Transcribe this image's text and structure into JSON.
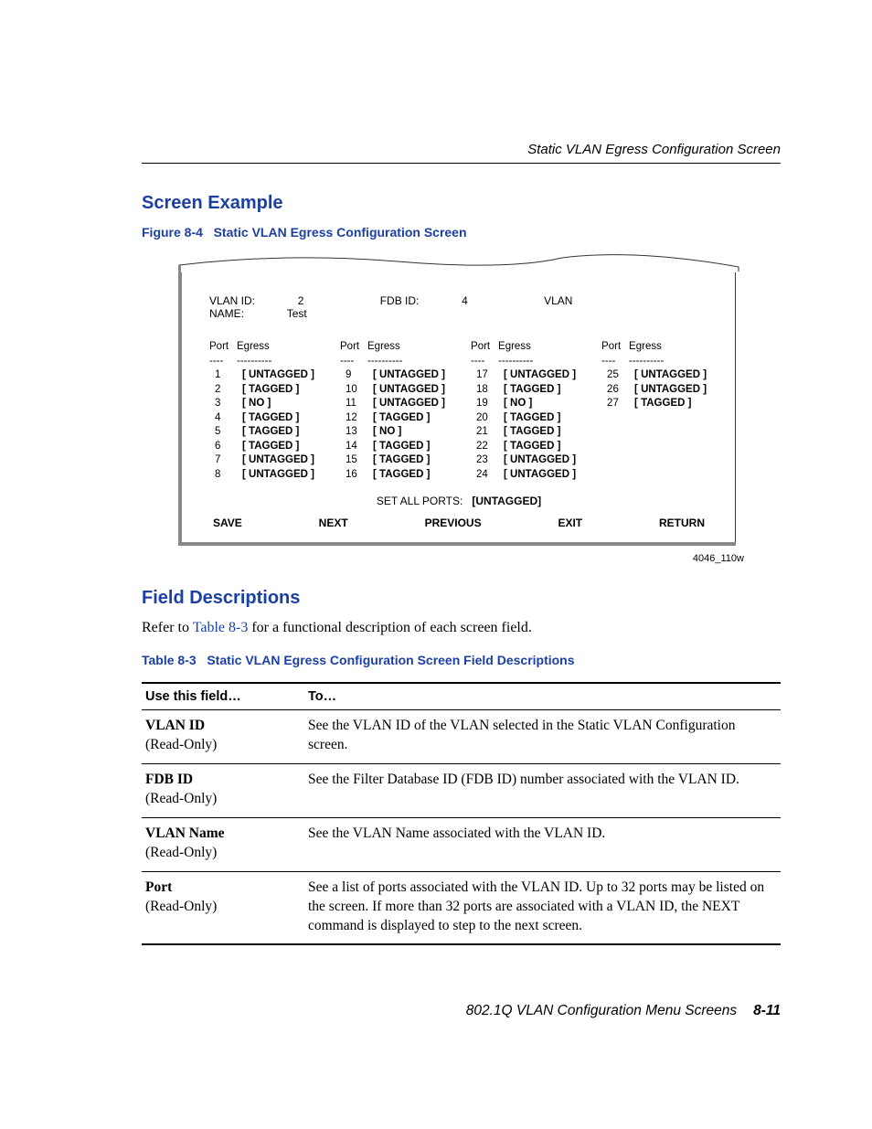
{
  "running_header": "Static VLAN Egress Configuration Screen",
  "section1_title": "Screen Example",
  "figure_caption_num": "Figure 8-4",
  "figure_caption_text": "Static VLAN Egress Configuration Screen",
  "screen": {
    "vlan_id_label": "VLAN ID:",
    "vlan_id_value": "2",
    "fdb_id_label": "FDB ID:",
    "fdb_id_value": "4",
    "vlan_name_label": "VLAN NAME:",
    "vlan_name_value": "Test",
    "col_headers": {
      "port": "Port",
      "egress": "Egress",
      "dash_p": "----",
      "dash_e": "----------"
    },
    "columns": [
      [
        {
          "port": "1",
          "egress": "[ UNTAGGED ]"
        },
        {
          "port": "2",
          "egress": "[ TAGGED ]"
        },
        {
          "port": "3",
          "egress": "[ NO ]"
        },
        {
          "port": "4",
          "egress": "[ TAGGED ]"
        },
        {
          "port": "5",
          "egress": "[ TAGGED ]"
        },
        {
          "port": "6",
          "egress": "[ TAGGED ]"
        },
        {
          "port": "7",
          "egress": "[ UNTAGGED ]"
        },
        {
          "port": "8",
          "egress": "[ UNTAGGED ]"
        }
      ],
      [
        {
          "port": "9",
          "egress": "[ UNTAGGED ]"
        },
        {
          "port": "10",
          "egress": "[ UNTAGGED ]"
        },
        {
          "port": "11",
          "egress": "[ UNTAGGED ]"
        },
        {
          "port": "12",
          "egress": "[ TAGGED ]"
        },
        {
          "port": "13",
          "egress": "[ NO ]"
        },
        {
          "port": "14",
          "egress": "[ TAGGED ]"
        },
        {
          "port": "15",
          "egress": "[ TAGGED ]"
        },
        {
          "port": "16",
          "egress": "[ TAGGED ]"
        }
      ],
      [
        {
          "port": "17",
          "egress": "[ UNTAGGED ]"
        },
        {
          "port": "18",
          "egress": "[ TAGGED ]"
        },
        {
          "port": "19",
          "egress": "[ NO ]"
        },
        {
          "port": "20",
          "egress": "[ TAGGED ]"
        },
        {
          "port": "21",
          "egress": "[ TAGGED ]"
        },
        {
          "port": "22",
          "egress": "[ TAGGED ]"
        },
        {
          "port": "23",
          "egress": "[ UNTAGGED ]"
        },
        {
          "port": "24",
          "egress": "[ UNTAGGED ]"
        }
      ],
      [
        {
          "port": "25",
          "egress": "[ UNTAGGED ]"
        },
        {
          "port": "26",
          "egress": "[ UNTAGGED ]"
        },
        {
          "port": "27",
          "egress": "[ TAGGED ]"
        }
      ]
    ],
    "set_all_label": "SET ALL PORTS:",
    "set_all_value": "[UNTAGGED]",
    "buttons": {
      "save": "SAVE",
      "next": "NEXT",
      "previous": "PREVIOUS",
      "exit": "EXIT",
      "return": "RETURN"
    }
  },
  "figure_id": "4046_110w",
  "section2_title": "Field Descriptions",
  "refer_prefix": "Refer to ",
  "refer_link": "Table 8-3",
  "refer_suffix": " for a functional description of each screen field.",
  "table_caption_num": "Table 8-3",
  "table_caption_text": "Static VLAN Egress Configuration Screen Field Descriptions",
  "table_headers": {
    "field": "Use this field…",
    "to": "To…"
  },
  "rows": [
    {
      "name": "VLAN ID",
      "ro": "(Read-Only)",
      "desc": "See the VLAN ID of the VLAN selected in the Static VLAN Configuration screen."
    },
    {
      "name": "FDB ID",
      "ro": "(Read-Only)",
      "desc": "See the Filter Database ID (FDB ID) number associated with the VLAN ID."
    },
    {
      "name": "VLAN Name",
      "ro": "(Read-Only)",
      "desc": "See the VLAN Name associated with the VLAN ID."
    },
    {
      "name": "Port",
      "ro": "(Read-Only)",
      "desc": "See a list of ports associated with the VLAN ID. Up to 32 ports may be listed on the screen. If more than 32 ports are associated with a VLAN ID, the NEXT command is displayed to step to the next screen."
    }
  ],
  "footer_text": "802.1Q VLAN Configuration Menu Screens",
  "footer_page": "8-11"
}
